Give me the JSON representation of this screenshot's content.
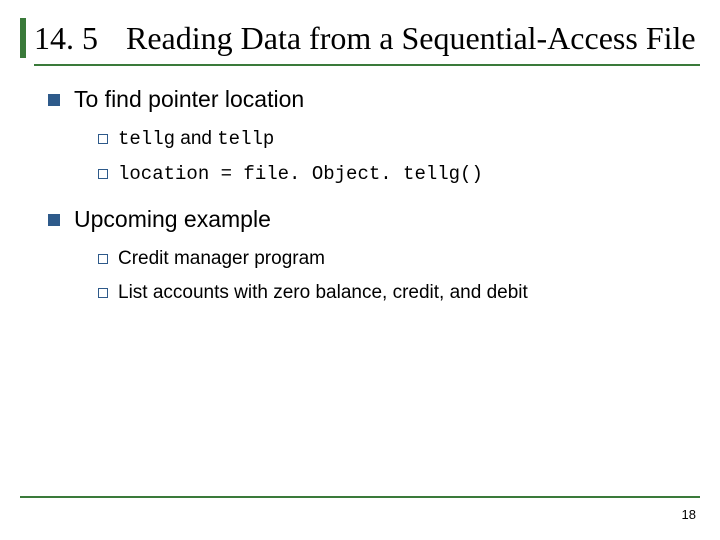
{
  "title": {
    "section_number": "14. 5",
    "text": "Reading Data from a Sequential-Access File"
  },
  "bullets": [
    {
      "text": "To find pointer location",
      "sub": [
        {
          "pre": "tellg",
          "mid": " and ",
          "post": "tellp"
        },
        {
          "code": "location = file. Object. tellg()"
        }
      ]
    },
    {
      "text": "Upcoming example",
      "sub": [
        {
          "plain": "Credit manager program"
        },
        {
          "plain": "List accounts with zero balance, credit, and debit"
        }
      ]
    }
  ],
  "page_number": "18"
}
